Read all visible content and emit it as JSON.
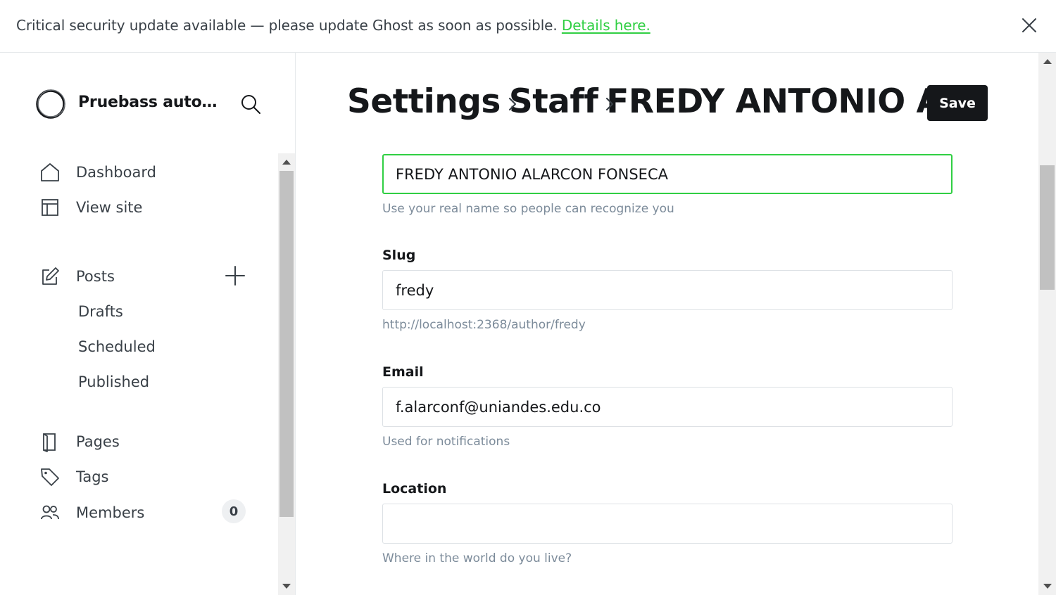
{
  "banner": {
    "message": "Critical security update available — please update Ghost as soon as possible.",
    "link_text": "Details here."
  },
  "sidebar": {
    "site_title": "Pruebass autom...",
    "nav": {
      "dashboard": "Dashboard",
      "view_site": "View site",
      "posts": "Posts",
      "drafts": "Drafts",
      "scheduled": "Scheduled",
      "published": "Published",
      "pages": "Pages",
      "tags": "Tags",
      "members": "Members",
      "members_count": "0"
    }
  },
  "header": {
    "crumb_1": "Settings",
    "crumb_2": "Staff",
    "crumb_3": "FREDY ANTONIO ALARCON FONSECA",
    "save_label": "Save"
  },
  "form": {
    "name": {
      "value": "FREDY ANTONIO ALARCON FONSECA",
      "hint": "Use your real name so people can recognize you"
    },
    "slug": {
      "label": "Slug",
      "value": "fredy",
      "hint": "http://localhost:2368/author/fredy"
    },
    "email": {
      "label": "Email",
      "value": "f.alarconf@uniandes.edu.co",
      "hint": "Used for notifications"
    },
    "location": {
      "label": "Location",
      "value": "",
      "hint": "Where in the world do you live?"
    }
  },
  "colors": {
    "accent_green": "#30cf43",
    "text_dark": "#15171a",
    "hint_gray": "#7c8b9a"
  }
}
